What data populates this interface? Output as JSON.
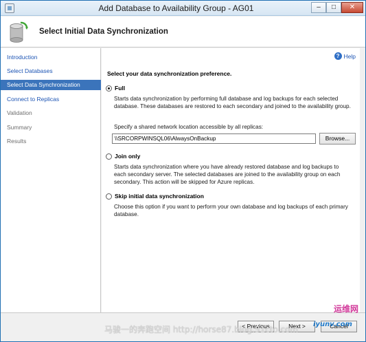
{
  "window": {
    "title": "Add Database to Availability Group - AG01",
    "min": "–",
    "max": "□",
    "close": "✕"
  },
  "header": {
    "title": "Select Initial Data Synchronization"
  },
  "nav": {
    "items": [
      {
        "label": "Introduction"
      },
      {
        "label": "Select Databases"
      },
      {
        "label": "Select Data Synchronization"
      },
      {
        "label": "Connect to Replicas"
      },
      {
        "label": "Validation"
      },
      {
        "label": "Summary"
      },
      {
        "label": "Results"
      }
    ]
  },
  "content": {
    "help": "Help",
    "lead": "Select your data synchronization preference.",
    "full": {
      "label": "Full",
      "description": "Starts data synchronization by performing full database and log backups for each selected database. These databases are restored to each secondary and joined to the availability group.",
      "share_label": "Specify a shared network location accessible by all replicas:",
      "share_value": "\\\\SRCORPWINSQL06\\AlwaysOnBackup",
      "browse": "Browse..."
    },
    "join": {
      "label": "Join only",
      "description": "Starts data synchronization where you have already restored database and log backups to each secondary server. The selected databases are joined to the availability group on each secondary. This action will be skipped for Azure replicas."
    },
    "skip": {
      "label": "Skip initial data synchronization",
      "description": "Choose this option if you want to perform your own database and log backups of each primary database."
    }
  },
  "footer": {
    "previous": "< Previous",
    "next": "Next >",
    "cancel": "Cancel"
  },
  "watermark": {
    "text": "马骏一的奔跑空间 http://horse87.blog.51cto.com",
    "logo_cn": "运维网",
    "logo_url": "iyunv.com"
  },
  "colors": {
    "accent": "#3b74bb",
    "link": "#1c54b4"
  }
}
